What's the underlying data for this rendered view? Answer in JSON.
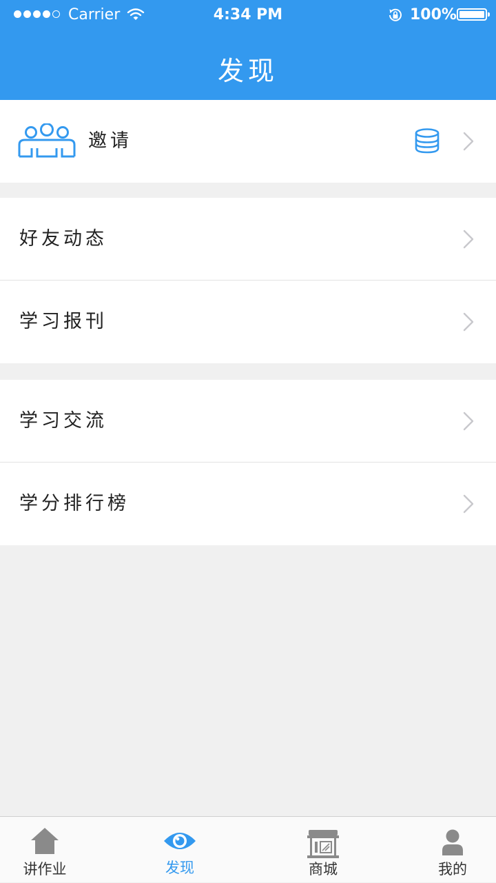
{
  "status_bar": {
    "carrier": "Carrier",
    "time": "4:34 PM",
    "battery": "100%",
    "icons": [
      "signal-dots-icon",
      "wifi-icon",
      "rotation-lock-icon",
      "battery-icon"
    ]
  },
  "header": {
    "title": "发现"
  },
  "invite": {
    "label": "邀请",
    "icons": [
      "people-group-icon",
      "coins-stack-icon",
      "chevron-right-icon"
    ]
  },
  "group_one": [
    {
      "label": "好友动态"
    },
    {
      "label": "学习报刊"
    }
  ],
  "group_two": [
    {
      "label": "学习交流"
    },
    {
      "label": "学分排行榜"
    }
  ],
  "tabs": [
    {
      "label": "讲作业",
      "icon": "home-icon",
      "active": false
    },
    {
      "label": "发现",
      "icon": "eye-icon",
      "active": true
    },
    {
      "label": "商城",
      "icon": "store-icon",
      "active": false
    },
    {
      "label": "我的",
      "icon": "user-icon",
      "active": false
    }
  ],
  "colors": {
    "accent": "#3399ef",
    "background": "#f0f0f0",
    "tab_inactive": "#8a8a8a"
  }
}
